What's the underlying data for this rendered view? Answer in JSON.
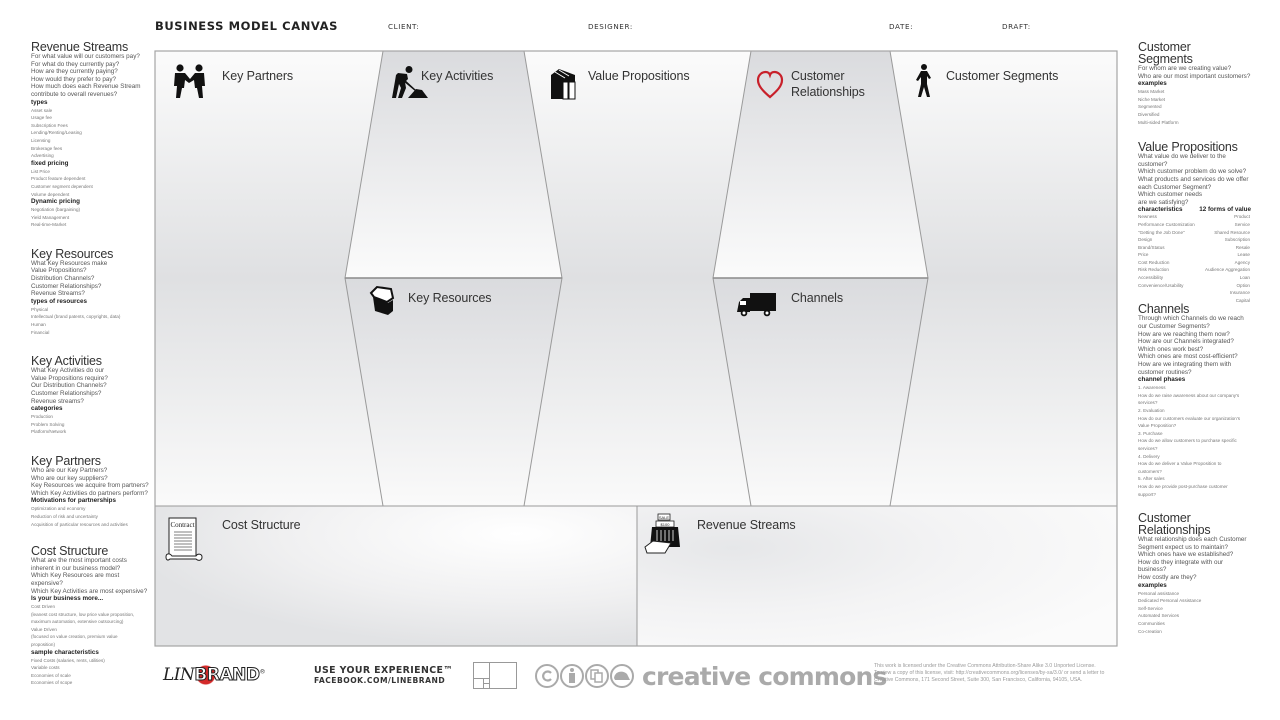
{
  "header": {
    "title": "BUSINESS MODEL CANVAS",
    "client_label": "CLIENT:",
    "designer_label": "DESIGNER:",
    "date_label": "DATE:",
    "draft_label": "DRAFT:"
  },
  "canvas": {
    "blocks": {
      "key_partners": {
        "label": "Key Partners",
        "icon": "handshake-icon"
      },
      "key_activities": {
        "label": "Key Activities",
        "icon": "worker-shovel-icon"
      },
      "key_resources": {
        "label": "Key Resources",
        "icon": "open-chest-icon"
      },
      "value_propositions": {
        "label": "Value Propositions",
        "icon": "gift-boxes-icon"
      },
      "customer_relationships": {
        "label_line1": "Customer",
        "label_line2": "Relationships",
        "icon": "heart-icon"
      },
      "channels": {
        "label": "Channels",
        "icon": "truck-icon"
      },
      "customer_segments": {
        "label": "Customer Segments",
        "icon": "walking-person-icon"
      },
      "cost_structure": {
        "label": "Cost Structure",
        "icon": "contract-icon",
        "icon_text": "Contract"
      },
      "revenue_streams": {
        "label": "Revenue Streams",
        "icon": "cash-register-icon",
        "icon_text_sale": "SALE",
        "icon_text_amount": "$100"
      }
    },
    "colors": {
      "heart": "#c8202a",
      "border": "#9a9a9a",
      "shade": "#dcdde0"
    }
  },
  "left_panel": [
    {
      "title": "Revenue Streams",
      "questions": [
        "For what value will our customers pay?",
        "For what do they currently pay?",
        "How are they currently paying?",
        "How would they prefer to pay?",
        "How much does each Revenue Stream",
        "contribute to overall revenues?"
      ],
      "groups": [
        {
          "heading": "types",
          "items": [
            "Asset sale",
            "Usage fee",
            "Subscription Fees",
            "Lending/Renting/Leasing",
            "Licensing",
            "Brokerage fees",
            "Advertising"
          ]
        },
        {
          "heading": "fixed pricing",
          "items": [
            "List Price",
            "Product feature dependent",
            "Customer segment dependent",
            "Volume dependent"
          ]
        },
        {
          "heading": "Dynamic pricing",
          "items": [
            "Negotiation (bargaining)",
            "Yield Management",
            "Real-time-Market"
          ]
        }
      ]
    },
    {
      "title": "Key Resources",
      "questions": [
        "What Key Resources make",
        "Value Propositions?",
        "Distribution Channels?",
        "Customer Relationships?",
        "Revenue Streams?"
      ],
      "groups": [
        {
          "heading": "types of resources",
          "items": [
            "Physical",
            "Intellectual (brand patents, copyrights, data)",
            "Human",
            "Financial"
          ]
        }
      ]
    },
    {
      "title": "Key Activities",
      "questions": [
        "What Key Activities do our",
        "Value Propositions require?",
        "Our Distribution Channels?",
        "Customer Relationships?",
        "Revenue streams?"
      ],
      "groups": [
        {
          "heading": "categories",
          "items": [
            "Production",
            "Problem Solving",
            "Platform/Network"
          ]
        }
      ]
    },
    {
      "title": "Key Partners",
      "questions": [
        "Who are our Key Partners?",
        "Who are our key suppliers?",
        "Key Resources we acquire from partners?",
        "Which Key Activities do partners perform?"
      ],
      "groups": [
        {
          "heading": "Motivations for partnerships",
          "items": [
            "Optimization and economy",
            "Reduction of risk and uncertainty",
            "Acquisition of particular resources and activities"
          ]
        }
      ]
    },
    {
      "title": "Cost Structure",
      "questions": [
        "What are the most important costs",
        "inherent in our business model?",
        "Which Key Resources are most",
        "expensive?",
        "Which Key Activities are most expensive?"
      ],
      "groups": [
        {
          "heading": "Is your business more...",
          "items": [
            "Cost Driven",
            "(leanest cost structure, low price value proposition,",
            "maximum automation, extensive outsourcing)",
            "Value Driven",
            "(focused on value creation, premium value",
            "proposition)"
          ]
        },
        {
          "heading": "sample characteristics",
          "items": [
            "Fixed Costs (salaries, rents, utilities)",
            "Variable costs",
            "Economies of scale",
            "Economies of scope"
          ]
        }
      ]
    }
  ],
  "right_panel": {
    "customer_segments": {
      "title_line1": "Customer",
      "title_line2": "Segments",
      "questions": [
        "For whom are we creating value?",
        "Who are our most important customers?"
      ],
      "heading": "examples",
      "items": [
        "Mass Market",
        "Niche Market",
        "Segmented",
        "Diversified",
        "Multi-sided Platform"
      ]
    },
    "value_propositions": {
      "title": "Value Propositions",
      "questions": [
        "What value do we deliver to the",
        "customer?",
        "Which customer problem do we solve?",
        "What products and services do we offer",
        "each Customer Segment?",
        "Which customer needs",
        "are we satisfying?"
      ],
      "heading_left": "characteristics",
      "heading_right": "12 forms of value",
      "items_left": [
        "Newness",
        "Performance Customization",
        "\"Getting the Job Done\"",
        "Design",
        "Brand/Status",
        "Price",
        "Cost Reduction",
        "Risk Reduction",
        "Accessibility",
        "Convenience/Usability"
      ],
      "items_right": [
        "Product",
        "Service",
        "Shared Resource",
        "Subscription",
        "Resale",
        "Lease",
        "Agency",
        "Audience Aggregation",
        "Loan",
        "Option",
        "Insurance",
        "Capital"
      ]
    },
    "channels": {
      "title": "Channels",
      "questions": [
        "Through which Channels do we reach",
        "our Customer Segments?",
        "How are we reaching them now?",
        "How are our Channels integrated?",
        "Which ones work best?",
        "Which ones are most cost-efficient?",
        "How are we integrating them with",
        "customer routines?"
      ],
      "heading": "channel phases",
      "items": [
        "1. Awareness",
        "How do we raise awareness about our company's",
        "services?",
        "2. Evaluation",
        "How do our customers evaluate our organization's",
        "Value Proposition?",
        "3. Purchase",
        "How do we allow customers to purchase specific",
        "services?",
        "4. Delivery",
        "How do we deliver a Value Proposition to",
        "customers?",
        "5. After sales",
        "How do we provide post-purchase customer",
        "support?"
      ]
    },
    "customer_relationships": {
      "title_line1": "Customer",
      "title_line2": "Relationships",
      "questions": [
        "What relationship does each Customer",
        "Segment expect us to maintain?",
        "Which ones have we established?",
        "How do they integrate with our",
        "business?",
        "How costly are they?"
      ],
      "heading": "examples",
      "items": [
        "Personal assistance",
        "Dedicated Personal Assistance",
        "Self-Service",
        "Automated Services",
        "Communities",
        "Co-creation"
      ]
    }
  },
  "footer": {
    "linebrand_left": "LIN",
    "linebrand_right": "BRAND",
    "tagline": "USE YOUR EXPERIENCE™",
    "facebook": "FACEBOOK.COM/LINEBRAND",
    "cc_brand": "creative commons",
    "cc_icons": [
      "cc-icon",
      "attribution-icon",
      "noncommercial-icon",
      "share-alike-icon"
    ],
    "license_lines": [
      "This work is licensed under the Creative Commons Attribution-Share Alike 3.0 Unported License.",
      "To view a copy of this license, visit: http://creativecommons.org/licenses/by-sa/3.0/ or send a letter to",
      "Creative Commons, 171 Second Street, Suite 300, San Francisco, California, 94105, USA."
    ]
  }
}
